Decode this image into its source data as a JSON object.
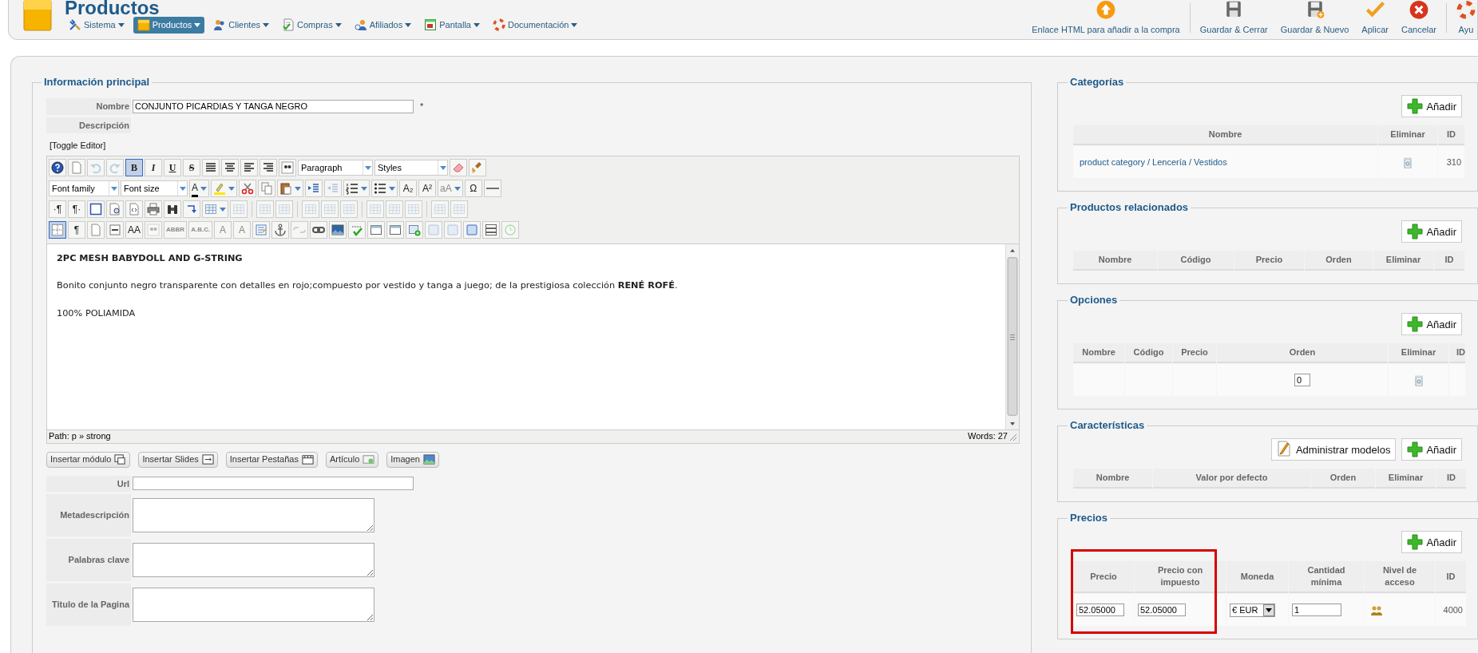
{
  "header": {
    "title": "Productos",
    "menu": [
      {
        "label": "Sistema",
        "selected": false
      },
      {
        "label": "Productos",
        "selected": true
      },
      {
        "label": "Clientes",
        "selected": false
      },
      {
        "label": "Compras",
        "selected": false
      },
      {
        "label": "Afiliados",
        "selected": false
      },
      {
        "label": "Pantalla",
        "selected": false
      },
      {
        "label": "Documentación",
        "selected": false
      }
    ],
    "toolbar": [
      {
        "label": "Enlace HTML para añadir a la compra"
      },
      {
        "label": "Guardar & Cerrar"
      },
      {
        "label": "Guardar & Nuevo"
      },
      {
        "label": "Aplicar"
      },
      {
        "label": "Cancelar"
      },
      {
        "label": "Ayu"
      }
    ]
  },
  "main": {
    "legend": "Información principal",
    "name_label": "Nombre",
    "name_value": "CONJUNTO PICARDIAS Y TANGA NEGRO",
    "required_mark": "*",
    "description_label": "Descripción",
    "toggle_editor": "[Toggle Editor]",
    "editor": {
      "toolbar_rows": [
        [
          {
            "kind": "button",
            "pressed": false,
            "disabled": false
          },
          {
            "kind": "button",
            "pressed": false,
            "disabled": false
          },
          {
            "kind": "button",
            "pressed": false,
            "disabled": true
          },
          {
            "kind": "button",
            "pressed": false,
            "disabled": true
          },
          {
            "kind": "button",
            "label": "B",
            "pressed": true,
            "disabled": false
          },
          {
            "kind": "button",
            "label": "I",
            "pressed": false,
            "disabled": false
          },
          {
            "kind": "button",
            "label": "U",
            "pressed": false,
            "disabled": false
          },
          {
            "kind": "button",
            "label": "S",
            "pressed": false,
            "disabled": false
          },
          {
            "kind": "button",
            "pressed": false,
            "disabled": false
          },
          {
            "kind": "button",
            "pressed": false,
            "disabled": false
          },
          {
            "kind": "button",
            "pressed": false,
            "disabled": false
          },
          {
            "kind": "button",
            "pressed": false,
            "disabled": false
          },
          {
            "kind": "button",
            "pressed": false,
            "disabled": false
          },
          {
            "kind": "select",
            "label": "Paragraph"
          },
          {
            "kind": "select",
            "label": "Styles"
          },
          {
            "kind": "button",
            "pressed": false,
            "disabled": false
          },
          {
            "kind": "button",
            "pressed": false,
            "disabled": false
          }
        ],
        [
          {
            "kind": "select",
            "label": "Font family"
          },
          {
            "kind": "select",
            "label": "Font size"
          },
          {
            "kind": "split",
            "label": "A",
            "pressed": false,
            "disabled": false
          },
          {
            "kind": "split",
            "pressed": false,
            "disabled": false
          },
          {
            "kind": "button",
            "pressed": false,
            "disabled": false
          },
          {
            "kind": "button",
            "pressed": false,
            "disabled": false
          },
          {
            "kind": "split",
            "pressed": false,
            "disabled": false
          },
          {
            "kind": "button",
            "pressed": false,
            "disabled": false
          },
          {
            "kind": "button",
            "pressed": false,
            "disabled": true
          },
          {
            "kind": "split",
            "pressed": false,
            "disabled": false
          },
          {
            "kind": "split",
            "pressed": false,
            "disabled": false
          },
          {
            "kind": "button",
            "label": "A₂",
            "pressed": false,
            "disabled": false
          },
          {
            "kind": "button",
            "label": "A²",
            "pressed": false,
            "disabled": false
          },
          {
            "kind": "split",
            "label": "aA",
            "pressed": false,
            "disabled": true
          },
          {
            "kind": "button",
            "label": "Ω",
            "pressed": false,
            "disabled": false
          },
          {
            "kind": "button",
            "pressed": false,
            "disabled": false
          }
        ],
        [
          {
            "kind": "button",
            "label": "·¶",
            "pressed": false,
            "disabled": false
          },
          {
            "kind": "button",
            "label": "¶·",
            "pressed": false,
            "disabled": false
          },
          {
            "kind": "button",
            "pressed": false,
            "disabled": false
          },
          {
            "kind": "button",
            "pressed": false,
            "disabled": false
          },
          {
            "kind": "button",
            "pressed": false,
            "disabled": false
          },
          {
            "kind": "button",
            "pressed": false,
            "disabled": false
          },
          {
            "kind": "button",
            "pressed": false,
            "disabled": false
          },
          {
            "kind": "button",
            "pressed": false,
            "disabled": false
          },
          {
            "kind": "split",
            "pressed": false,
            "disabled": false
          },
          {
            "kind": "button",
            "pressed": false,
            "disabled": true
          },
          {
            "kind": "separator"
          },
          {
            "kind": "button",
            "pressed": false,
            "disabled": true
          },
          {
            "kind": "button",
            "pressed": false,
            "disabled": true
          },
          {
            "kind": "separator"
          },
          {
            "kind": "button",
            "pressed": false,
            "disabled": true
          },
          {
            "kind": "button",
            "pressed": false,
            "disabled": true
          },
          {
            "kind": "button",
            "pressed": false,
            "disabled": true
          },
          {
            "kind": "separator"
          },
          {
            "kind": "button",
            "pressed": false,
            "disabled": true
          },
          {
            "kind": "button",
            "pressed": false,
            "disabled": true
          },
          {
            "kind": "button",
            "pressed": false,
            "disabled": true
          },
          {
            "kind": "separator"
          },
          {
            "kind": "button",
            "pressed": false,
            "disabled": true
          },
          {
            "kind": "button",
            "pressed": false,
            "disabled": true
          }
        ],
        [
          {
            "kind": "button",
            "pressed": true,
            "disabled": false
          },
          {
            "kind": "button",
            "label": "¶",
            "pressed": false,
            "disabled": false
          },
          {
            "kind": "button",
            "pressed": false,
            "disabled": false
          },
          {
            "kind": "button",
            "pressed": false,
            "disabled": false
          },
          {
            "kind": "button",
            "label": "AA",
            "pressed": false,
            "disabled": false
          },
          {
            "kind": "button",
            "pressed": false,
            "disabled": true
          },
          {
            "kind": "button",
            "label": "ABBR",
            "pressed": false,
            "disabled": true
          },
          {
            "kind": "button",
            "label": "A.B.C.",
            "pressed": false,
            "disabled": true
          },
          {
            "kind": "button",
            "label": "A",
            "pressed": false,
            "disabled": true
          },
          {
            "kind": "button",
            "label": "A",
            "pressed": false,
            "disabled": true
          },
          {
            "kind": "button",
            "pressed": false,
            "disabled": false
          },
          {
            "kind": "button",
            "pressed": false,
            "disabled": false
          },
          {
            "kind": "button",
            "pressed": false,
            "disabled": true
          },
          {
            "kind": "button",
            "pressed": false,
            "disabled": false
          },
          {
            "kind": "button",
            "pressed": false,
            "disabled": false
          },
          {
            "kind": "button",
            "pressed": false,
            "disabled": false
          },
          {
            "kind": "button",
            "pressed": false,
            "disabled": false
          },
          {
            "kind": "button",
            "pressed": false,
            "disabled": false
          },
          {
            "kind": "button",
            "pressed": false,
            "disabled": false
          },
          {
            "kind": "button",
            "pressed": false,
            "disabled": true
          },
          {
            "kind": "button",
            "pressed": false,
            "disabled": true
          },
          {
            "kind": "button",
            "pressed": false,
            "disabled": false
          },
          {
            "kind": "button",
            "pressed": false,
            "disabled": false
          },
          {
            "kind": "button",
            "pressed": false,
            "disabled": true
          }
        ]
      ],
      "content": [
        {
          "text": "2PC MESH BABYDOLL AND G-STRING",
          "bold": true
        },
        {
          "text": "Bonito conjunto negro transparente con detalles en rojo;compuesto por vestido y tanga a juego; de la prestigiosa colección **RENÉ ROFÉ**.",
          "bold": false
        },
        {
          "text": "100% POLIAMIDA",
          "bold": false
        }
      ],
      "path": "Path:  p » strong",
      "words": "Words: 27"
    },
    "insert_buttons": [
      "Insertar módulo",
      "Insertar Slides",
      "Insertar Pestañas",
      "Artículo",
      "Imagen"
    ],
    "fields": [
      {
        "label": "Url",
        "kind": "input"
      },
      {
        "label": "Metadescripción",
        "kind": "textarea"
      },
      {
        "label": "Palabras clave",
        "kind": "textarea"
      },
      {
        "label": "Titulo de la Pagina",
        "kind": "textarea"
      }
    ]
  },
  "panels": [
    {
      "legend": "Categorías",
      "buttons": [
        {
          "label": "Añadir",
          "kind": "add"
        }
      ],
      "columns": [
        "Nombre",
        "Eliminar",
        "ID"
      ],
      "rows": [
        [
          {
            "kind": "link",
            "text": "product category / Lencería / Vestidos"
          },
          {
            "kind": "trash"
          },
          {
            "kind": "text",
            "text": "310"
          }
        ]
      ]
    },
    {
      "legend": "Productos relacionados",
      "buttons": [
        {
          "label": "Añadir",
          "kind": "add"
        }
      ],
      "columns": [
        "Nombre",
        "Código",
        "Precio",
        "Orden",
        "Eliminar",
        "ID"
      ]
    },
    {
      "legend": "Opciones",
      "buttons": [
        {
          "label": "Añadir",
          "kind": "add"
        }
      ],
      "columns": [
        "Nombre",
        "Código",
        "Precio",
        "Orden",
        "Eliminar",
        "ID"
      ],
      "rows": [
        [
          {
            "kind": "empty"
          },
          {
            "kind": "empty"
          },
          {
            "kind": "empty"
          },
          {
            "kind": "input",
            "value": "0"
          },
          {
            "kind": "trash"
          },
          {
            "kind": "empty"
          }
        ]
      ]
    },
    {
      "legend": "Características",
      "buttons": [
        {
          "label": "Administrar modelos",
          "kind": "edit"
        },
        {
          "label": "Añadir",
          "kind": "add"
        }
      ],
      "columns": [
        "Nombre",
        "Valor por defecto",
        "Orden",
        "Eliminar",
        "ID"
      ]
    },
    {
      "legend": "Precios",
      "buttons": [
        {
          "label": "Añadir",
          "kind": "add"
        }
      ],
      "highlight": {
        "kind": "frame",
        "color": "#d50000"
      },
      "columns": [
        "Precio",
        "Precio con impuesto",
        "Moneda",
        "Cantidad mínima",
        "Nivel de acceso",
        "ID"
      ],
      "rows": [
        [
          {
            "kind": "input",
            "value": "52.05000"
          },
          {
            "kind": "input",
            "value": "52.05000"
          },
          {
            "kind": "select",
            "value": "€ EUR"
          },
          {
            "kind": "input",
            "value": "1"
          },
          {
            "kind": "users"
          },
          {
            "kind": "text",
            "text": "4000"
          }
        ]
      ]
    }
  ]
}
